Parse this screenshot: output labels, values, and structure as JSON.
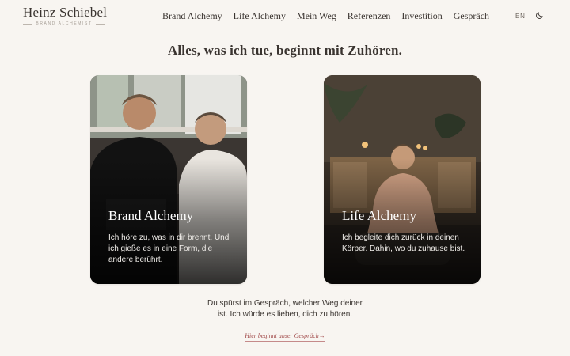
{
  "brand": {
    "name": "Heinz Schiebel",
    "subtitle": "BRAND ALCHEMIST"
  },
  "nav": {
    "items": [
      {
        "label": "Brand Alchemy"
      },
      {
        "label": "Life Alchemy"
      },
      {
        "label": "Mein Weg"
      },
      {
        "label": "Referenzen"
      },
      {
        "label": "Investition"
      },
      {
        "label": "Gespräch"
      }
    ],
    "language": "EN",
    "theme_icon": "moon-icon"
  },
  "main": {
    "headline": "Alles, was ich tue, beginnt mit Zuhören.",
    "cards": [
      {
        "title": "Brand Alchemy",
        "text": "Ich höre zu, was in dir brennt. Und ich gieße es in eine Form, die andere berührt."
      },
      {
        "title": "Life Alchemy",
        "text": "Ich begleite dich zurück in deinen Körper. Dahin, wo du zuhause bist."
      }
    ],
    "closing_line_1": "Du spürst im Gespräch, welcher Weg deiner",
    "closing_line_2": "ist. Ich würde es lieben, dich zu hören.",
    "cta": "Hier beginnt unser Gespräch→"
  },
  "colors": {
    "background": "#f8f5f1",
    "text": "#3a3430",
    "accent": "#a14a4a"
  }
}
